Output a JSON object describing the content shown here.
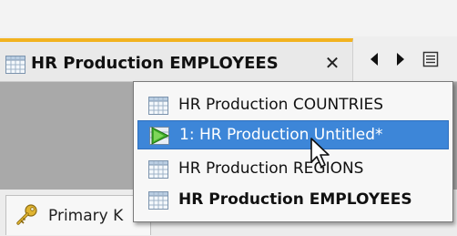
{
  "editor": {
    "active_tab": {
      "title": "HR Production EMPLOYEES",
      "close_symbol": "✕",
      "icon": "table-grid-icon"
    },
    "nav": {
      "left_icon": "triangle-left-icon",
      "right_icon": "triangle-right-icon",
      "list_icon": "document-list-icon"
    }
  },
  "tab_switcher_popup": {
    "items": [
      {
        "label": "HR Production COUNTRIES",
        "icon": "table-grid-icon",
        "selected": false,
        "bold": false
      },
      {
        "label": "1: HR Production Untitled*",
        "icon": "play-worksheet-icon",
        "selected": true,
        "bold": false
      },
      {
        "label": "HR Production REGIONS",
        "icon": "table-grid-icon",
        "selected": false,
        "bold": false
      },
      {
        "label": "HR Production EMPLOYEES",
        "icon": "table-grid-icon",
        "selected": false,
        "bold": true
      }
    ]
  },
  "bottom_tabs": {
    "visible_label": "Primary K",
    "icon": "key-icon"
  },
  "colors": {
    "active_tab_accent": "#f2b21f",
    "selection_blue": "#3d86d8",
    "editor_gray": "#a9a9a9"
  }
}
